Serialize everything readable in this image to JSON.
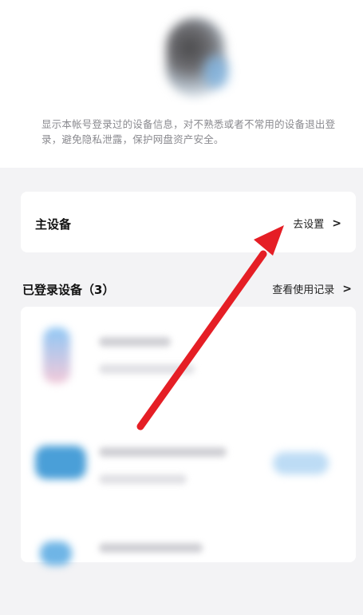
{
  "description": {
    "text": "显示本帐号登录过的设备信息，对不熟悉或者不常用的设备退出登录，避免隐私泄露，保护网盘资产安全。"
  },
  "main_device": {
    "label": "主设备",
    "action": "去设置"
  },
  "logged_in_section": {
    "title": "已登录设备（3）",
    "action": "查看使用记录"
  },
  "colors": {
    "arrow": "#e51e25",
    "background": "#f3f3f5",
    "card": "#ffffff"
  },
  "icons": {
    "chevron": "chevron-right-icon",
    "annotation": "red-arrow-annotation"
  }
}
